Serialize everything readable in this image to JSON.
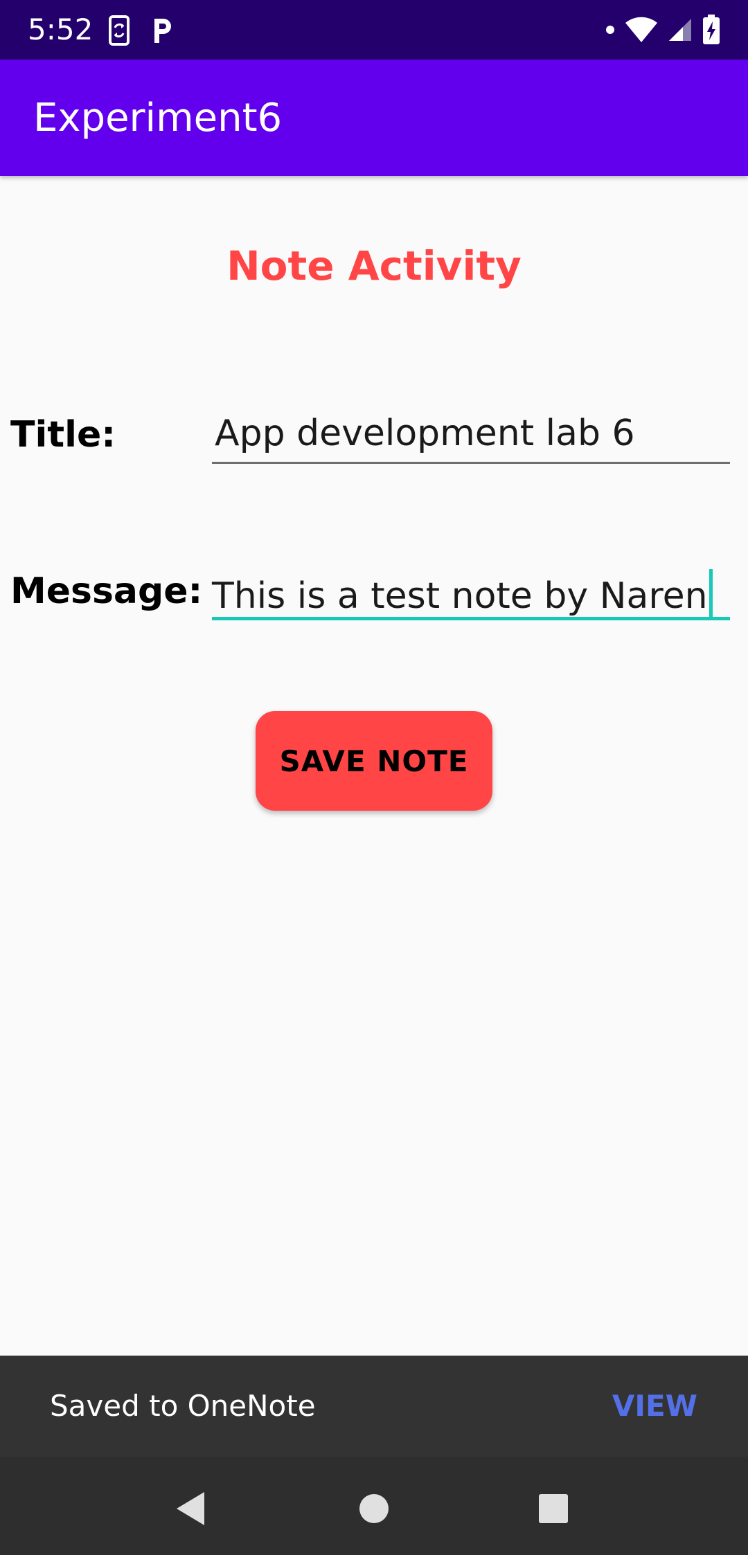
{
  "status_bar": {
    "time": "5:52",
    "left_icons": [
      "phone-sync-icon",
      "parking-icon"
    ],
    "right_icons": [
      "notification-dot-icon",
      "wifi-icon",
      "cell-signal-icon",
      "battery-charging-icon"
    ],
    "background": "#23006B"
  },
  "app_bar": {
    "title": "Experiment6",
    "background": "#6200EE"
  },
  "main": {
    "heading": "Note Activity",
    "heading_color": "#FF4545",
    "title_label": "Title:",
    "title_value": "App development lab 6",
    "message_label": "Message:",
    "message_value": "This is a test note by Naren",
    "focus_color": "#18C9B8",
    "save_button_label": "SAVE NOTE",
    "save_button_color": "#FF4545"
  },
  "snackbar": {
    "text": "Saved to OneNote",
    "action": "VIEW",
    "action_color": "#5470E8"
  },
  "nav_bar": {
    "buttons": [
      "back-icon",
      "home-icon",
      "recents-icon"
    ]
  }
}
